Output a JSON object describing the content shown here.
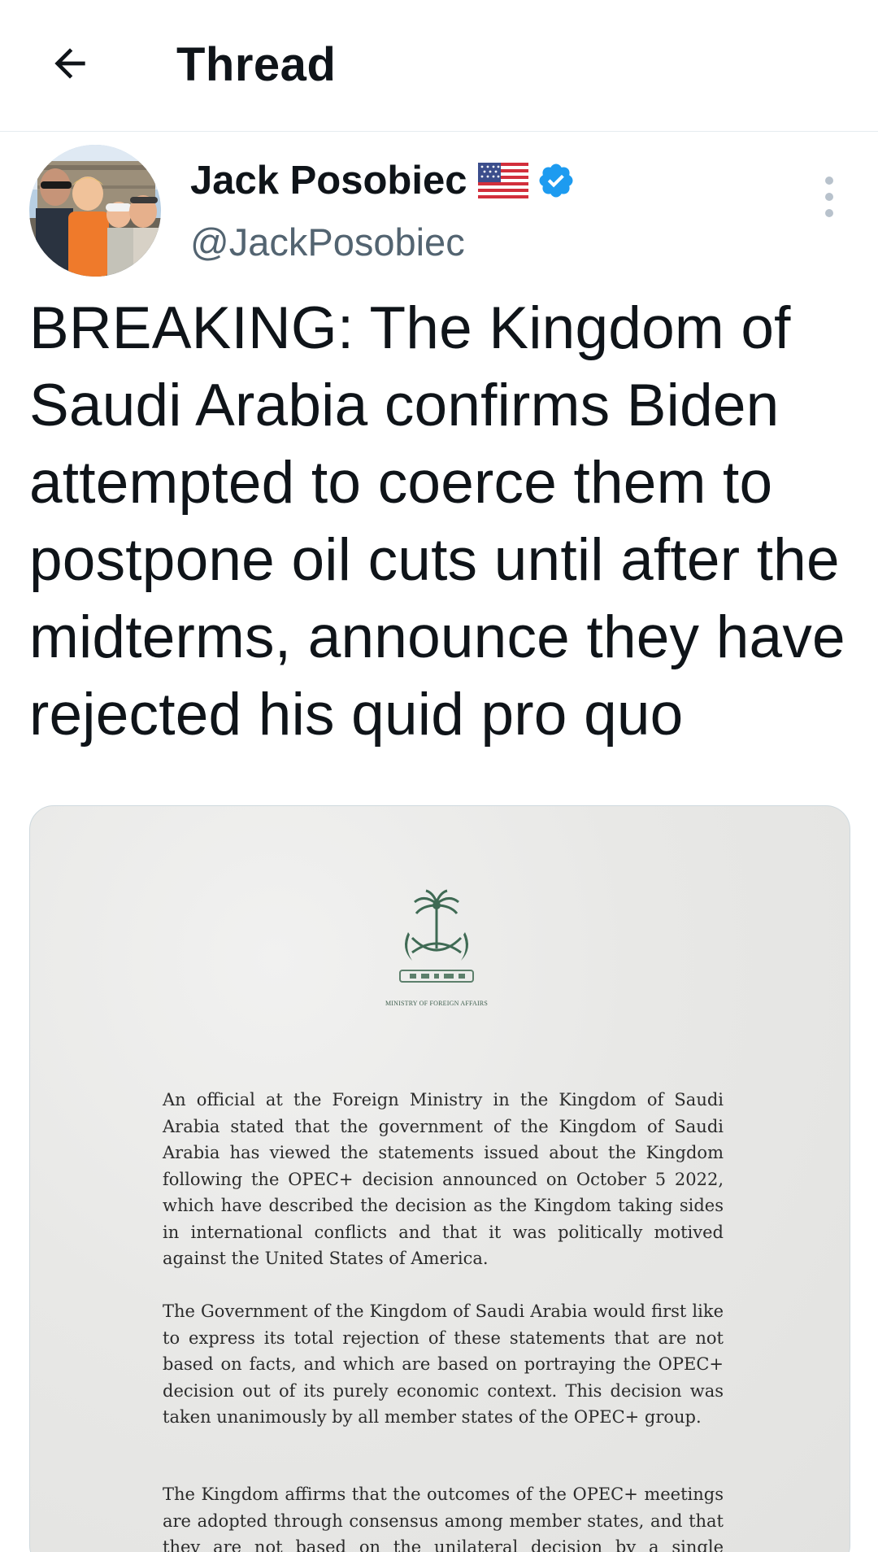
{
  "header": {
    "title": "Thread",
    "back_icon": "arrow-left-icon"
  },
  "tweet": {
    "author_name": "Jack Posobiec",
    "author_handle": "@JackPosobiec",
    "author_flag": "us-flag-emoji",
    "verified_icon": "verified-badge-icon",
    "verified_color": "#1d9bf0",
    "more_icon": "vertical-dots-icon",
    "text": "BREAKING: The Kingdom of Saudi Arabia confirms Biden attempted to coerce them to postpone oil cuts until after the midterms, announce they have rejected his quid pro quo"
  },
  "media": {
    "emblem_icon": "saudi-emblem-palm-swords-icon",
    "ministry_label": "MINISTRY OF FOREIGN AFFAIRS",
    "paragraphs": [
      "An official at the Foreign Ministry in the Kingdom of Saudi Arabia stated that the government of the Kingdom of Saudi Arabia has viewed the statements issued about the Kingdom following the OPEC+ decision announced on October 5 2022, which have described the decision as the Kingdom taking sides in international conflicts and that it was politically motived against the United States of America.",
      "The Government of the Kingdom of Saudi Arabia would first like to express its total rejection of these statements that are not based on facts, and which are based on portraying the OPEC+ decision out of its purely economic context. This decision was taken unanimously by all member states of the OPEC+ group.",
      "The Kingdom affirms that the outcomes of the OPEC+ meetings are adopted through consensus among member states, and that they are not based on the unilateral decision by a single country."
    ]
  }
}
